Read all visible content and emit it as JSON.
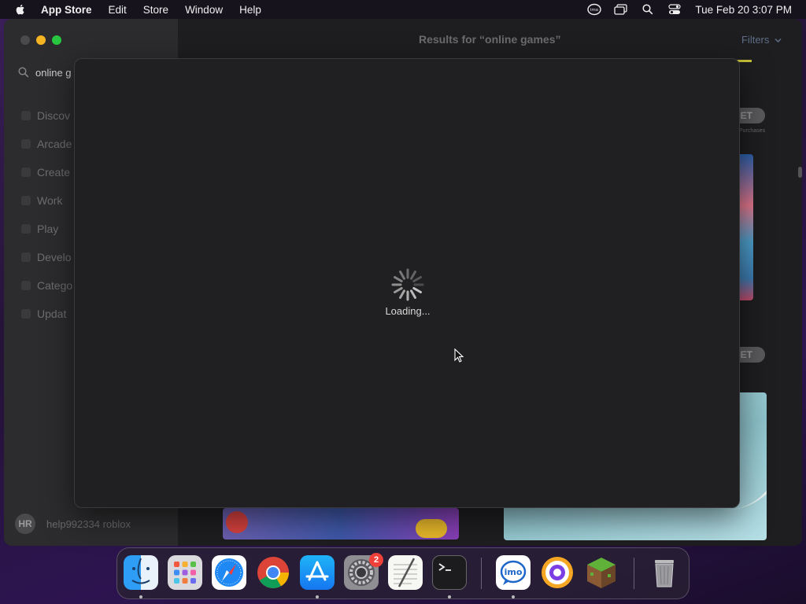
{
  "menubar": {
    "app_name": "App Store",
    "items": [
      "Edit",
      "Store",
      "Window",
      "Help"
    ],
    "clock": "Tue Feb 20  3:07 PM"
  },
  "sidebar": {
    "search_value": "online g",
    "nav_items": [
      "Discov",
      "Arcade",
      "Create",
      "Work",
      "Play",
      "Develo",
      "Catego",
      "Updat"
    ],
    "avatar_initials": "HR",
    "username": "help992334 roblox"
  },
  "main": {
    "title": "Results for “online games”",
    "filters_label": "Filters",
    "get_label": "ET",
    "iap_text": "Purchases"
  },
  "modal": {
    "loading_text": "Loading..."
  },
  "dock": {
    "apps": [
      "finder-icon",
      "launchpad-icon",
      "safari-icon",
      "chrome-icon",
      "app-store-icon",
      "system-settings-icon",
      "textedit-icon",
      "terminal-icon",
      "imo-icon",
      "vpn-icon",
      "minecraft-icon",
      "trash-icon"
    ],
    "settings_badge": "2"
  },
  "colors": {
    "accent": "#0a84ff",
    "close": "#4a4a4c",
    "minimize": "#f5b522",
    "maximize": "#28c840",
    "badge": "#f0403a"
  }
}
